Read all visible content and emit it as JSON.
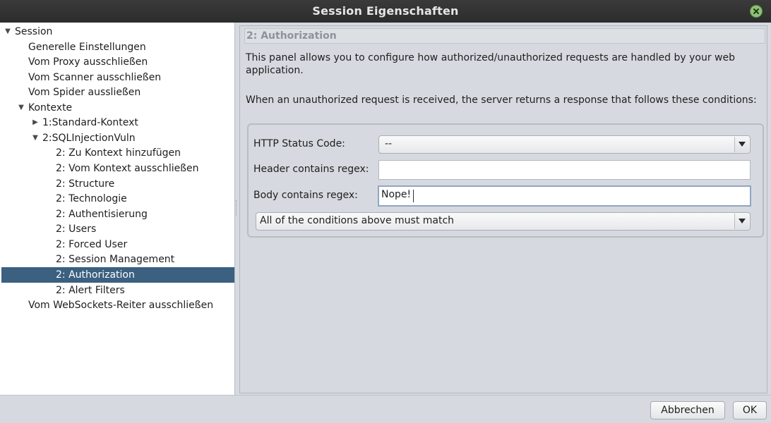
{
  "window": {
    "title": "Session Eigenschaften"
  },
  "tree": {
    "items": [
      {
        "label": "Session",
        "arrow": "▼"
      },
      {
        "label": "Generelle Einstellungen"
      },
      {
        "label": "Vom Proxy ausschließen"
      },
      {
        "label": "Vom Scanner ausschließen"
      },
      {
        "label": "Vom Spider aussließen"
      },
      {
        "label": "Kontexte",
        "arrow": "▼"
      },
      {
        "label": "1:Standard-Kontext",
        "arrow": "▶"
      },
      {
        "label": "2:SQLInjectionVuln",
        "arrow": "▼"
      },
      {
        "label": "2: Zu Kontext hinzufügen"
      },
      {
        "label": "2: Vom Kontext ausschließen"
      },
      {
        "label": "2: Structure"
      },
      {
        "label": "2: Technologie"
      },
      {
        "label": "2: Authentisierung"
      },
      {
        "label": "2: Users"
      },
      {
        "label": "2: Forced User"
      },
      {
        "label": "2: Session Management"
      },
      {
        "label": "2: Authorization"
      },
      {
        "label": "2: Alert Filters"
      },
      {
        "label": "Vom WebSockets-Reiter ausschließen"
      }
    ]
  },
  "panel": {
    "header": "2: Authorization",
    "description_1": "This panel allows you to configure how authorized/unauthorized requests are handled by your web application.",
    "description_2": "When an unauthorized request is received, the server returns a response that follows these conditions:",
    "status_code_label": "HTTP Status Code:",
    "status_code_value": "--",
    "header_regex_label": "Header contains regex:",
    "header_regex_value": "",
    "body_regex_label": "Body contains regex:",
    "body_regex_value": "Nope!",
    "match_mode_value": "All of the conditions above must match"
  },
  "buttons": {
    "cancel": "Abbrechen",
    "ok": "OK"
  }
}
